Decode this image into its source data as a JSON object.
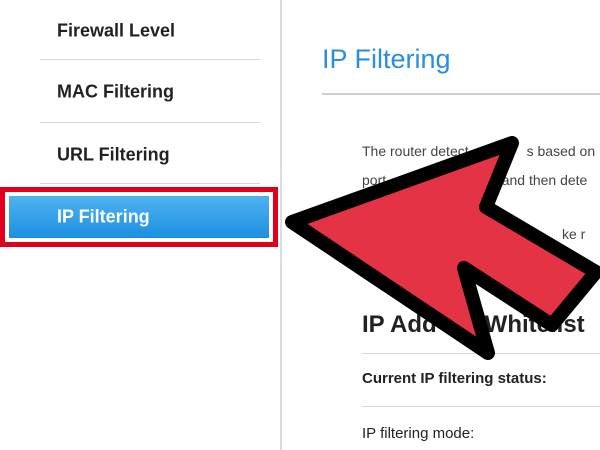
{
  "sidebar": {
    "items": [
      {
        "label": "Firewall Level"
      },
      {
        "label": "MAC Filtering"
      },
      {
        "label": "URL Filtering"
      },
      {
        "label": "IP Filtering",
        "active": true
      }
    ]
  },
  "main": {
    "title": "IP Filtering",
    "description_line1_left": "The router detect",
    "description_line1_right": "s based on",
    "description_line2_left": "port, a",
    "description_line2_right": "and then dete",
    "description_line3_right": "ke r",
    "section_title_left": "IP Add",
    "section_title_right": "Whitelist",
    "fields": [
      {
        "label": "Current IP filtering status:"
      },
      {
        "label": "IP filtering mode:"
      }
    ]
  },
  "colors": {
    "accent_blue": "#2a8de0",
    "active_item": "#1c8fe0",
    "highlight_border": "#e0001b",
    "arrow_fill": "#e53346",
    "arrow_outline": "#000000"
  },
  "icons": {
    "overlay_arrow": "red-arrow-pointer-icon"
  }
}
